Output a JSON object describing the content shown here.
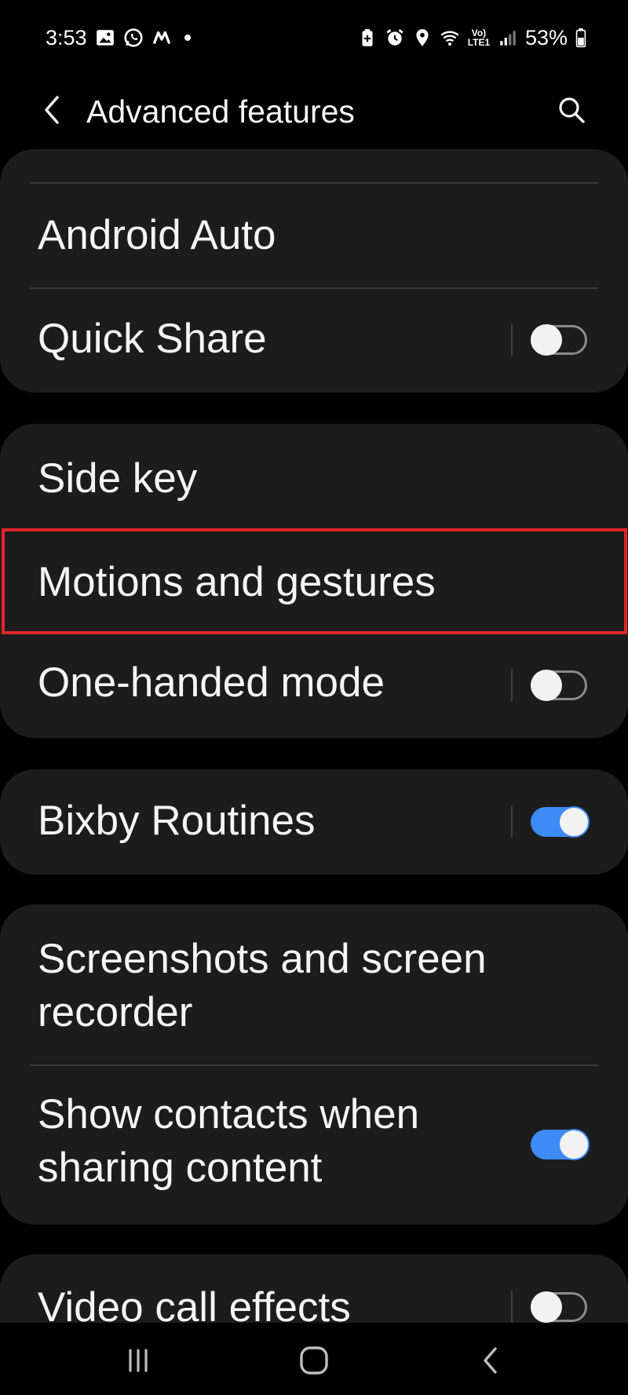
{
  "status_bar": {
    "time": "3:53",
    "battery": "53%",
    "left_icons": [
      "gallery-icon",
      "whatsapp-icon",
      "m-app-icon",
      "notification-dot"
    ],
    "right_icons": [
      "battery-saver-icon",
      "alarm-icon",
      "location-icon",
      "wifi-icon",
      "volte-lte-icon",
      "signal-icon",
      "battery-icon"
    ],
    "volte_label": "Vo) LTE1"
  },
  "header": {
    "title": "Advanced features",
    "back_icon": "back-arrow-icon",
    "search_icon": "search-icon"
  },
  "sections": [
    {
      "items": [
        {
          "label": "Android Auto",
          "toggle": null
        },
        {
          "label": "Quick Share",
          "toggle": false
        }
      ]
    },
    {
      "items": [
        {
          "label": "Side key",
          "toggle": null
        },
        {
          "label": "Motions and gestures",
          "toggle": null,
          "highlighted": true
        },
        {
          "label": "One-handed mode",
          "toggle": false
        }
      ]
    },
    {
      "items": [
        {
          "label": "Bixby Routines",
          "toggle": true
        }
      ]
    },
    {
      "items": [
        {
          "label": "Screenshots and screen recorder",
          "toggle": null
        },
        {
          "label": "Show contacts when sharing content",
          "toggle": true
        }
      ]
    },
    {
      "items": [
        {
          "label": "Video call effects",
          "toggle": false
        }
      ]
    }
  ],
  "colors": {
    "background": "#000000",
    "card": "#1c1c1c",
    "toggle_on": "#3e8bf6",
    "highlight": "#e0252a"
  },
  "nav_bar": {
    "recents_icon": "recents-icon",
    "home_icon": "home-icon",
    "back_icon": "nav-back-icon"
  }
}
